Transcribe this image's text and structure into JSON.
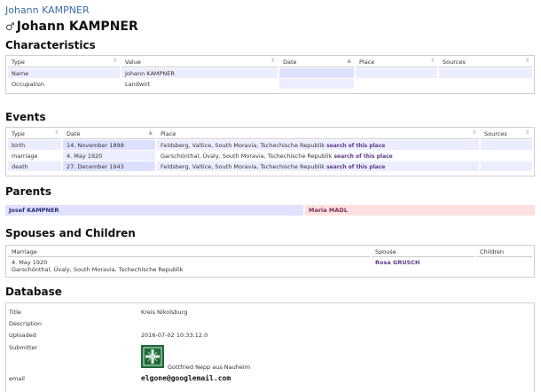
{
  "breadcrumb": "Johann KAMPNER",
  "person": {
    "name": "Johann KAMPNER",
    "gender_icon": "male-icon"
  },
  "characteristics": {
    "heading": "Characteristics",
    "columns": [
      "Type",
      "Value",
      "Date",
      "Place",
      "Sources"
    ],
    "rows": [
      {
        "type": "Name",
        "value": "Johann KAMPNER",
        "date": "",
        "place": "",
        "sources": ""
      },
      {
        "type": "Occupation",
        "value": "Landwirt",
        "date": "",
        "place": "",
        "sources": ""
      }
    ]
  },
  "events": {
    "heading": "Events",
    "columns": [
      "Type",
      "Date",
      "Place",
      "Sources"
    ],
    "search_link": "search of this place",
    "rows": [
      {
        "type": "birth",
        "date": "14. November 1898",
        "place": "Feldsberg, Valtice, South Moravia, Tschechische Republik"
      },
      {
        "type": "marriage",
        "date": "4. May 1920",
        "place": "Garschönthal, Úvaly, South Moravia, Tschechische Republik"
      },
      {
        "type": "death",
        "date": "27. December 1943",
        "place": "Feldsberg, Valtice, South Moravia, Tschechische Republik"
      }
    ]
  },
  "parents": {
    "heading": "Parents",
    "father": "Josef KAMPNER",
    "mother": "Maria MADL"
  },
  "spouses": {
    "heading": "Spouses and Children",
    "columns": [
      "Marriage",
      "Spouse",
      "Children"
    ],
    "marriage_date": "4. May 1920",
    "marriage_place": "Garschönthal, Úvaly, South Moravia, Tschechische Republik",
    "spouse": "Rosa GRUSCH",
    "children": ""
  },
  "database": {
    "heading": "Database",
    "title_label": "Title",
    "title_value": "Kreis Nikolsburg",
    "description_label": "Description",
    "uploaded_label": "Uploaded",
    "uploaded_value": "2016-07-02 10:33:12.0",
    "submitter_label": "Submitter",
    "submitter_value": "Gottfried Nepp aus Nauheim",
    "email_label": "email",
    "email_value": "elgone@googlemail.com"
  }
}
